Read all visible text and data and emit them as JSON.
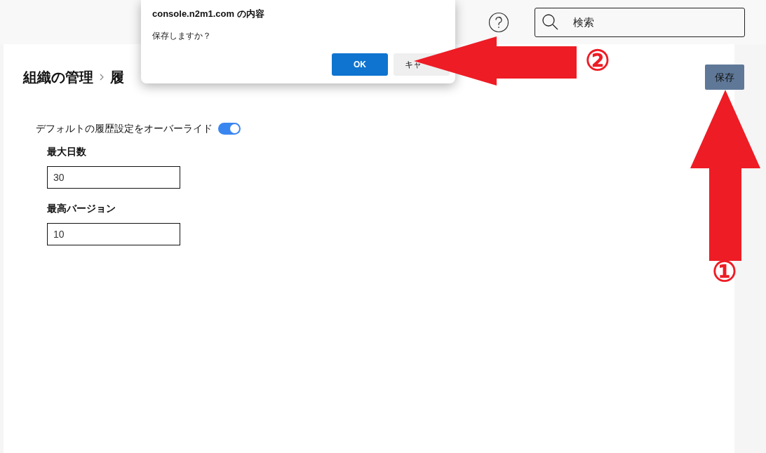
{
  "header": {
    "search": {
      "placeholder": "検索"
    }
  },
  "breadcrumb": [
    "組織の管理",
    "履"
  ],
  "save_button": "保存",
  "override": {
    "label": "デフォルトの履歴設定をオーバーライド",
    "on": true
  },
  "fields": [
    {
      "label": "最大日数",
      "value": "30"
    },
    {
      "label": "最高バージョン",
      "value": "10"
    }
  ],
  "dialog": {
    "title": "console.n2m1.com の内容",
    "message": "保存しますか？",
    "ok": "OK",
    "cancel": "キャ"
  },
  "annotations": [
    {
      "kind": "left",
      "label": "②"
    },
    {
      "kind": "up",
      "label": "①"
    }
  ]
}
